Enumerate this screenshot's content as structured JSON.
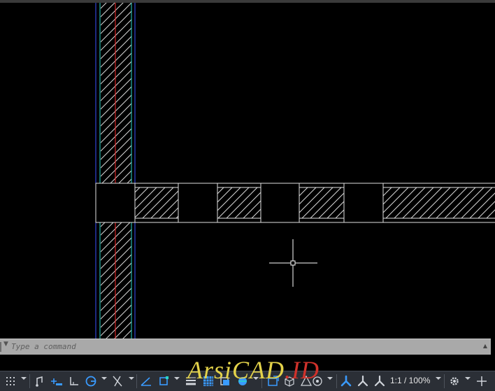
{
  "command_line": {
    "placeholder": "Type a command"
  },
  "watermark": {
    "part1": "ArsiCAD",
    "part2": ".ID",
    "color1": "#e3d24a",
    "color2": "#d0322b"
  },
  "status_bar": {
    "annotation_scale": "1:1 / 100%"
  },
  "colors": {
    "model_space_background": "#000000",
    "wall_line": "#ffffff",
    "wall_outline_blue": "#3a52ff",
    "wall_outline_cyan": "#28d6c8",
    "wall_centerline": "#ff2a2a",
    "statusbar_background": "#2b2f36",
    "accent_blue": "#3a9bff"
  }
}
